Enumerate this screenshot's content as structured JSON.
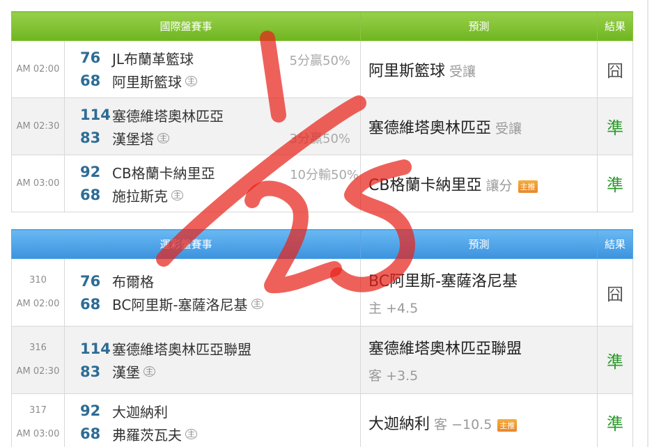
{
  "international": {
    "header": {
      "matches": "國際盤賽事",
      "prediction": "預測",
      "result": "結果"
    },
    "rows": [
      {
        "time": "AM 02:00",
        "away_score": "76",
        "away_team": "JL布蘭革籃球",
        "home_score": "68",
        "home_team": "阿里斯籃球",
        "home_mark": "主",
        "handicap": "5分贏50%",
        "pred_team": "阿里斯籃球",
        "pred_note": "受讓",
        "result": "囧"
      },
      {
        "time": "AM 02:30",
        "away_score": "114",
        "away_team": "塞德維塔奧林匹亞",
        "home_score": "83",
        "home_team": "漢堡塔",
        "home_mark": "主",
        "handicap": "3分贏50%",
        "pred_team": "塞德維塔奧林匹亞",
        "pred_note": "受讓",
        "result": "準"
      },
      {
        "time": "AM 03:00",
        "away_score": "92",
        "away_team": "CB格蘭卡納里亞",
        "home_score": "68",
        "home_team": "施拉斯克",
        "home_mark": "主",
        "handicap": "10分輸50%",
        "pred_team": "CB格蘭卡納里亞",
        "pred_note": "讓分",
        "tag": "主推",
        "result": "準"
      }
    ]
  },
  "lottery": {
    "header": {
      "matches": "運彩盤賽事",
      "prediction": "預測",
      "result": "結果"
    },
    "rows": [
      {
        "code": "310",
        "time": "AM 02:00",
        "away_score": "76",
        "away_team": "布爾格",
        "home_score": "68",
        "home_team": "BC阿里斯-塞薩洛尼基",
        "home_mark": "主",
        "pred_team": "BC阿里斯-塞薩洛尼基",
        "pred_line": "主 +4.5",
        "result": "囧"
      },
      {
        "code": "316",
        "time": "AM 02:30",
        "away_score": "114",
        "away_team": "塞德維塔奧林匹亞聯盟",
        "home_score": "83",
        "home_team": "漢堡",
        "home_mark": "主",
        "pred_team": "塞德維塔奧林匹亞聯盟",
        "pred_line": "客 +3.5",
        "result": "準"
      },
      {
        "code": "317",
        "time": "AM 03:00",
        "away_score": "92",
        "away_team": "大迦納利",
        "home_score": "68",
        "home_team": "弗羅茨瓦夫",
        "home_mark": "主",
        "pred_team": "大迦納利",
        "pred_line": "客 −10.5",
        "tag": "主推",
        "result": "準"
      }
    ]
  },
  "annotation": {
    "handwritten_text": "1/25",
    "color": "#e8241c"
  },
  "colors": {
    "green_header": "#7cbf2e",
    "blue_header": "#4a9fe4",
    "hit": "#2a9a2a",
    "score": "#2d6c94"
  }
}
